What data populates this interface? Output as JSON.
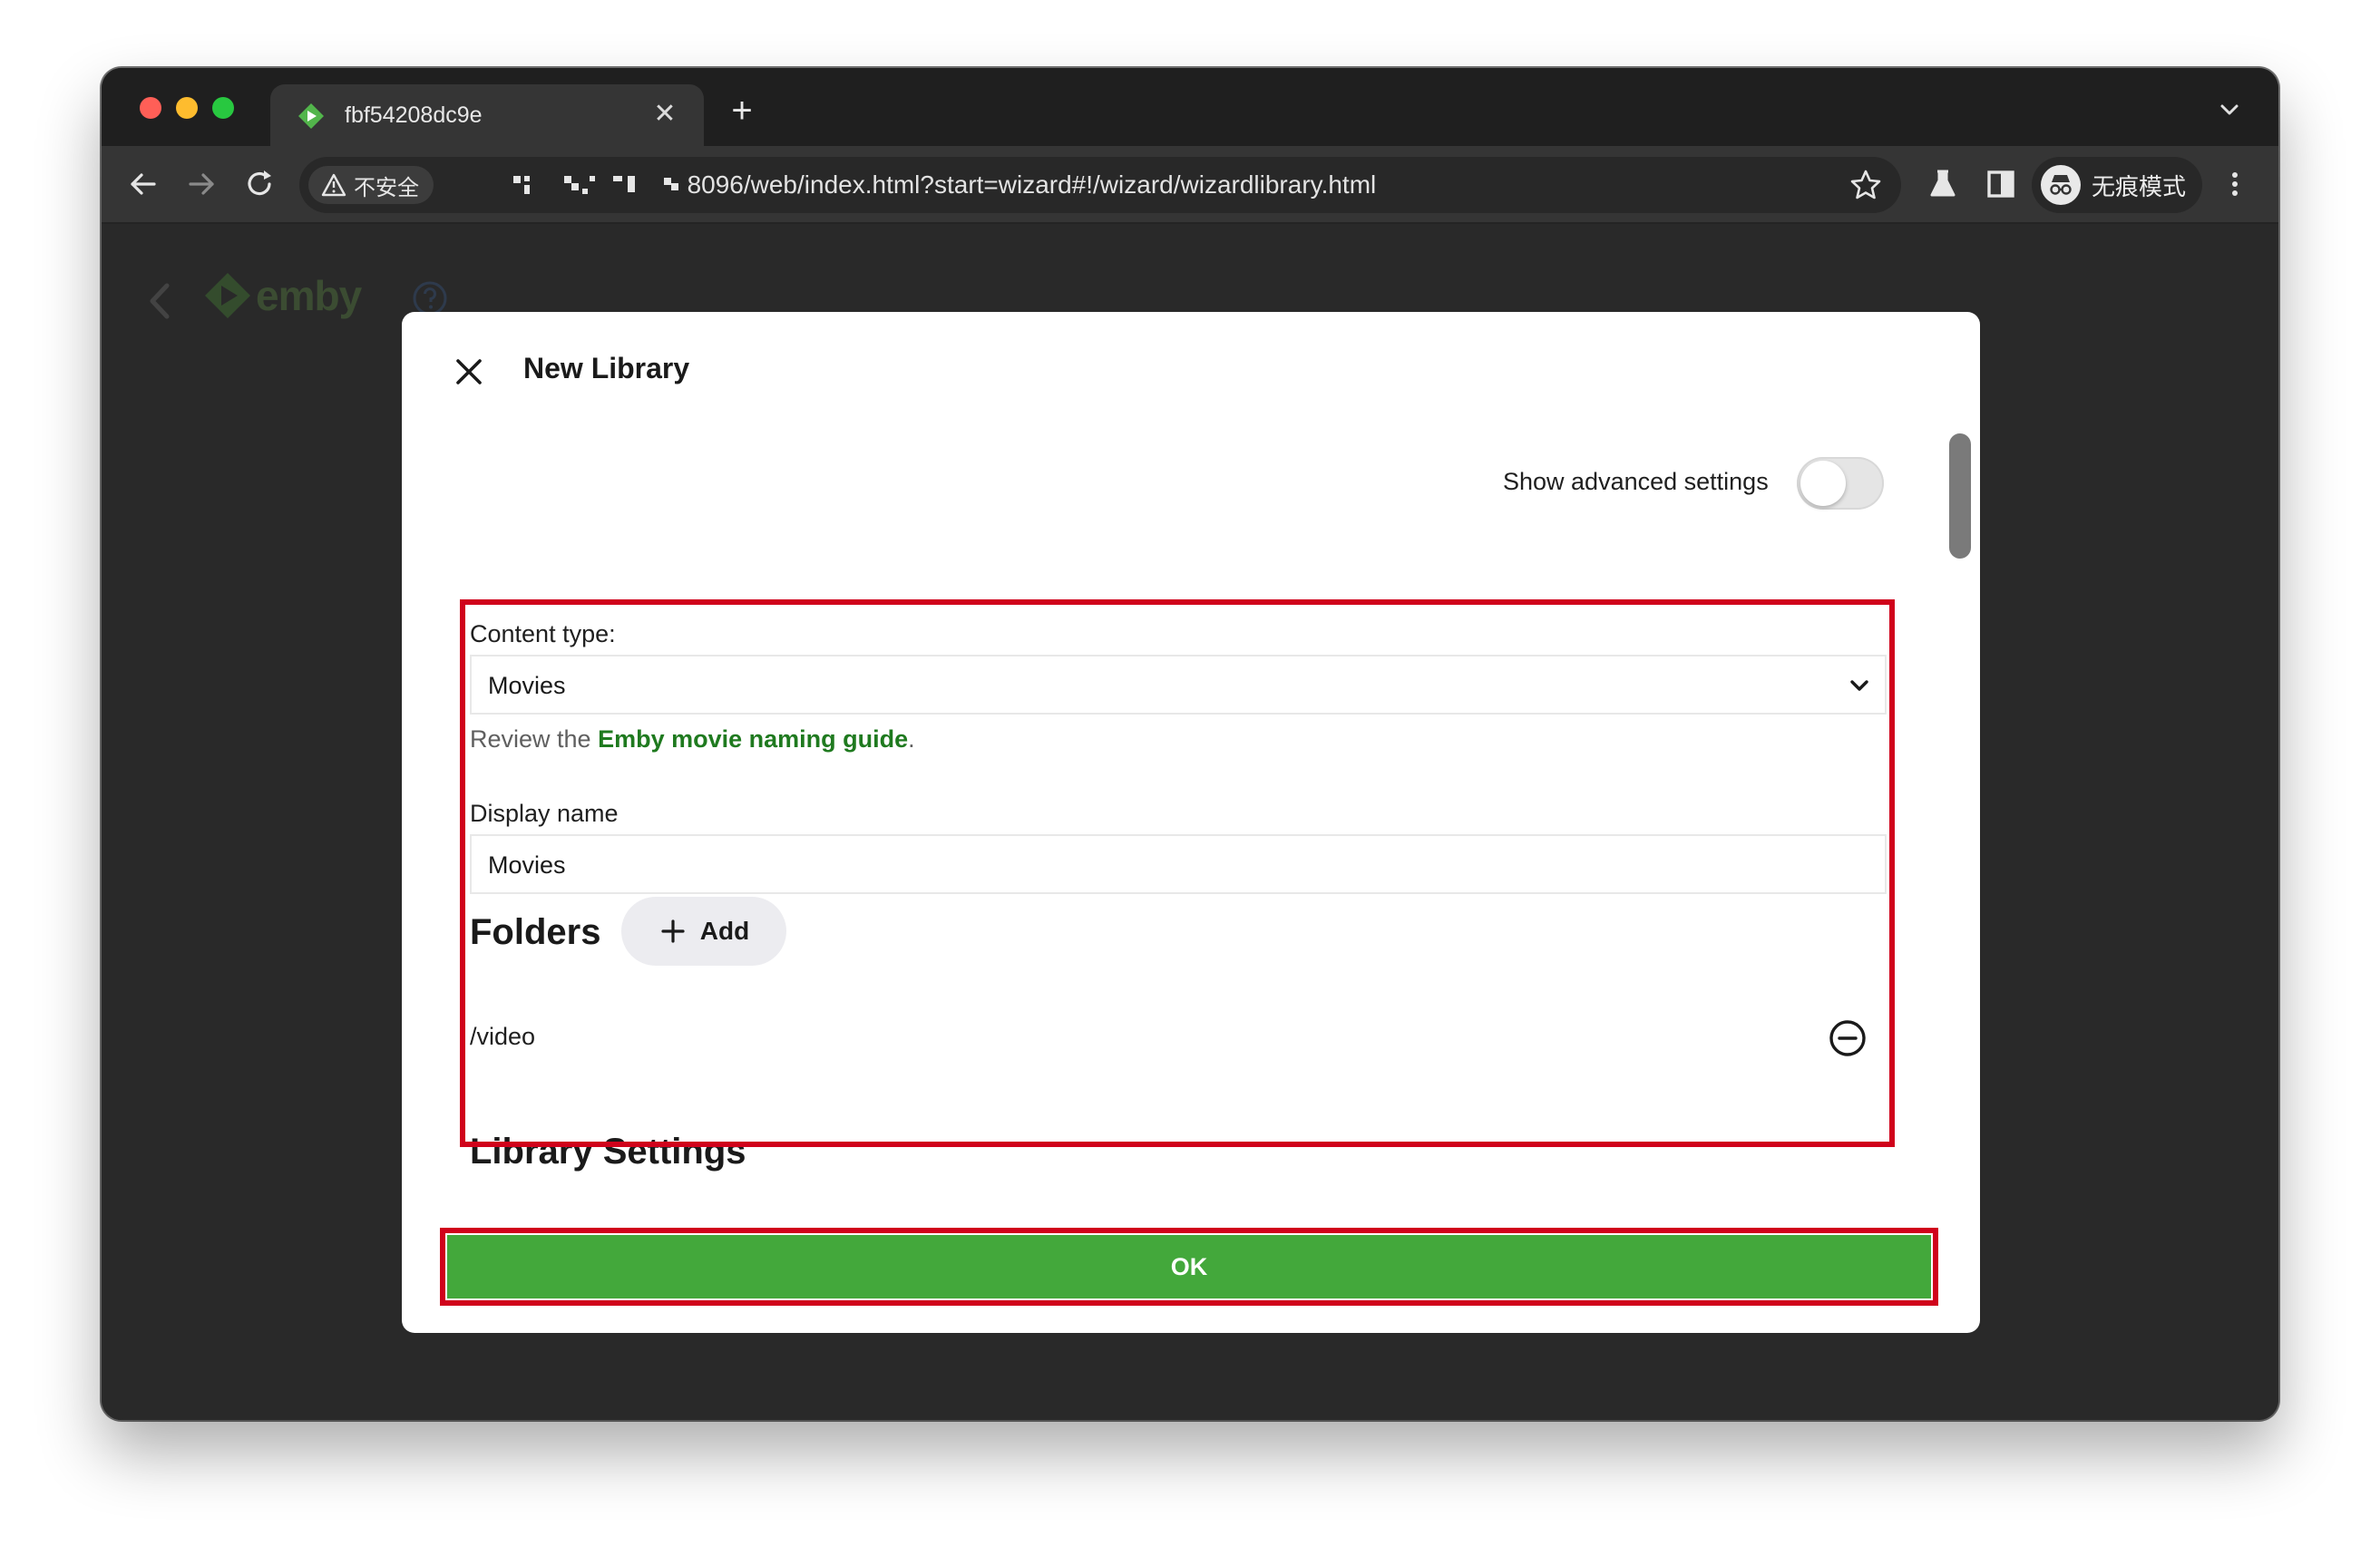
{
  "browser": {
    "tab_title": "fbf54208dc9e",
    "security_label": "不安全",
    "url": "8096/web/index.html?start=wizard#!/wizard/wizardlibrary.html",
    "profile_label": "无痕模式"
  },
  "dialog": {
    "title": "New Library",
    "advanced_toggle_label": "Show advanced settings",
    "advanced_enabled": false,
    "content_type_label": "Content type:",
    "content_type_value": "Movies",
    "hint_prefix": "Review the ",
    "hint_link": "Emby movie naming guide",
    "hint_suffix": ".",
    "display_name_label": "Display name",
    "display_name_value": "Movies",
    "folders_title": "Folders",
    "add_label": "Add",
    "folders": [
      "/video"
    ],
    "library_settings_title": "Library Settings",
    "ok_label": "OK"
  },
  "colors": {
    "accent_green": "#43a83b",
    "link_green": "#1f7a1f",
    "highlight_red": "#d0021b"
  }
}
